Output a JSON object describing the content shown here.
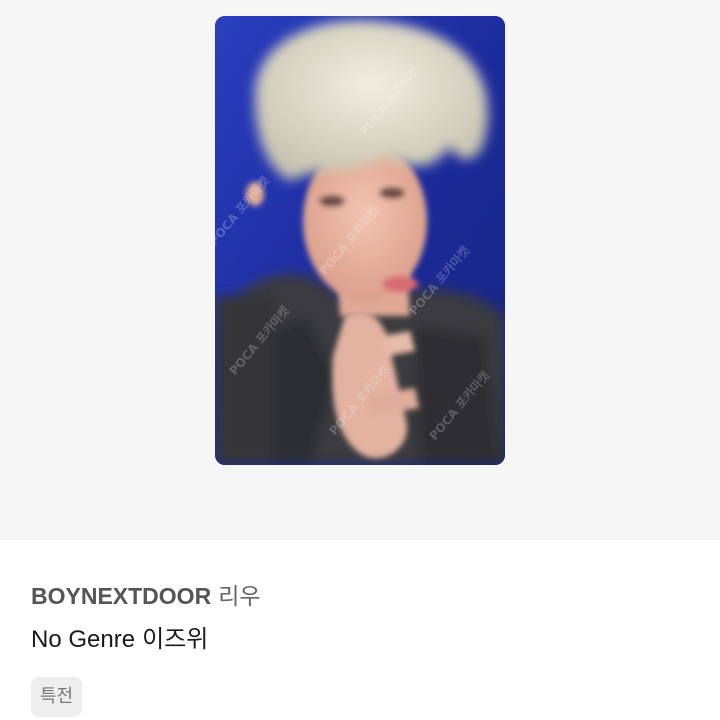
{
  "product": {
    "artist_group": "BOYNEXTDOOR",
    "member": "리우",
    "album": "No Genre",
    "version": "이즈위",
    "tags": [
      "특전"
    ]
  },
  "photo": {
    "watermark": "POCA 포카마켓"
  },
  "colors": {
    "image_background": "#f6f6f6",
    "card_background": "#1f2fa8",
    "tag_background": "#eeeeee",
    "artist_text": "#555555",
    "album_text": "#1a1a1a"
  }
}
